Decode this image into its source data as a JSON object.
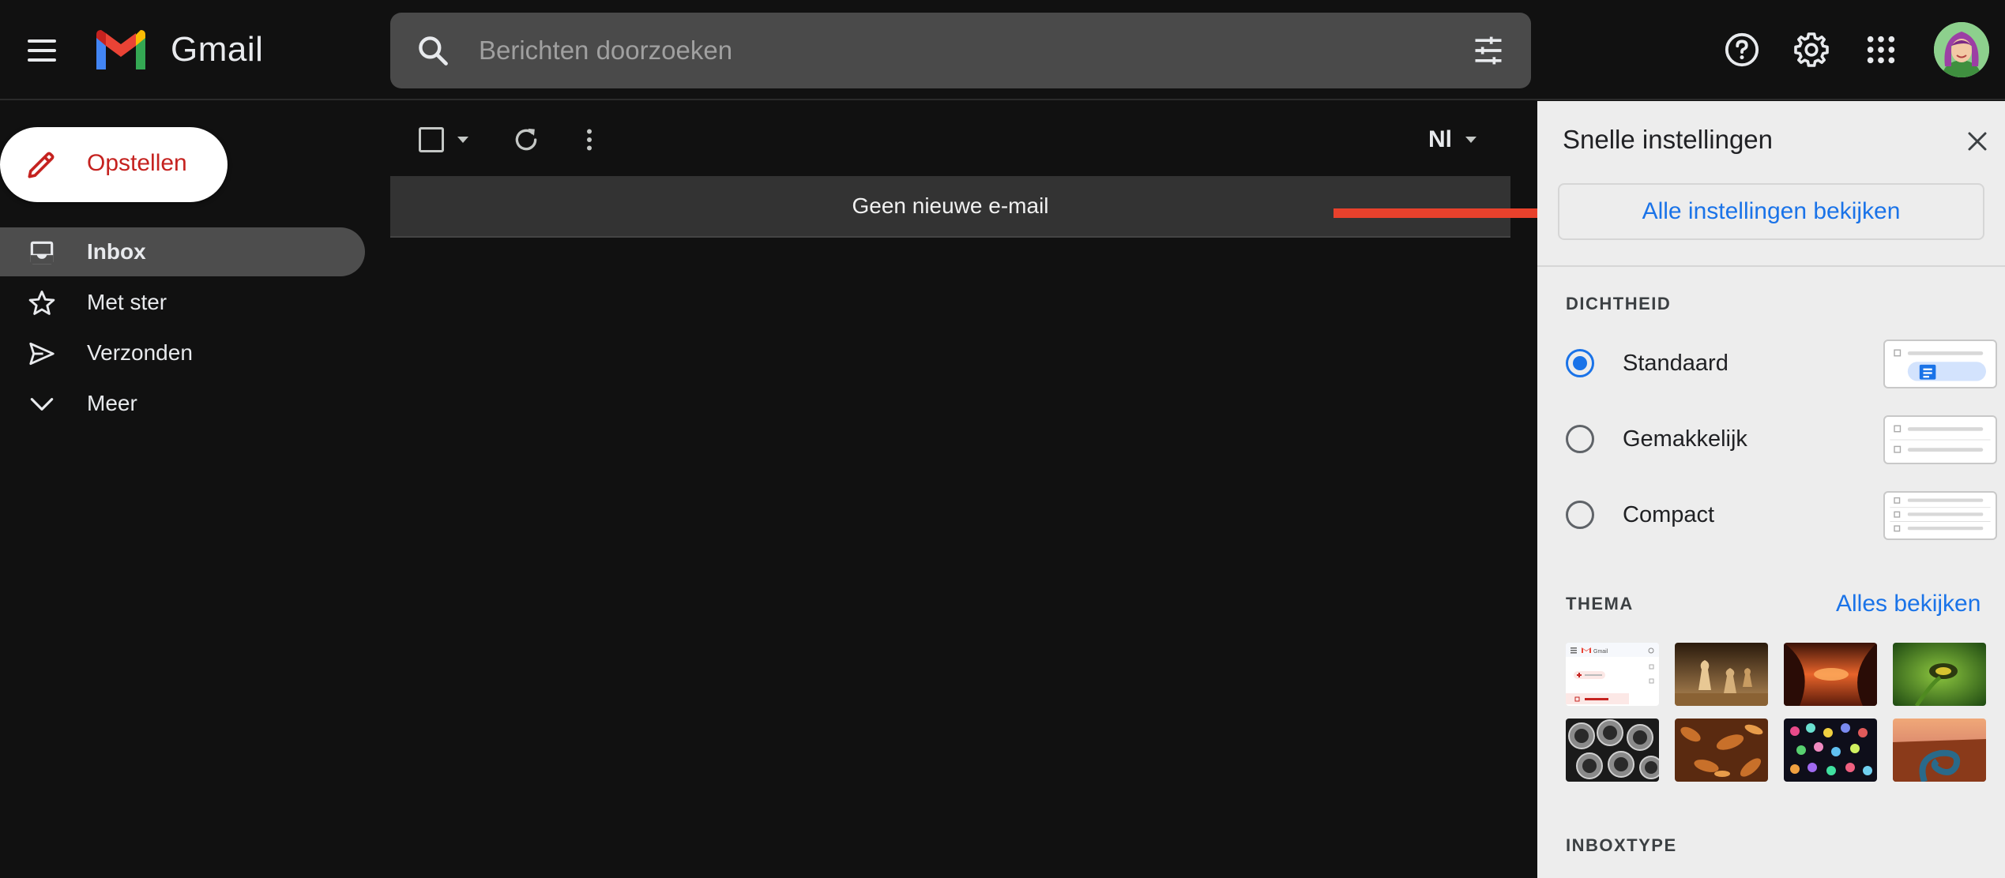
{
  "app": {
    "name": "Gmail"
  },
  "search": {
    "placeholder": "Berichten doorzoeken"
  },
  "compose": {
    "label": "Opstellen"
  },
  "sidebar": {
    "items": [
      {
        "label": "Inbox",
        "icon": "inbox-icon",
        "active": true
      },
      {
        "label": "Met ster",
        "icon": "star-icon",
        "active": false
      },
      {
        "label": "Verzonden",
        "icon": "send-icon",
        "active": false
      },
      {
        "label": "Meer",
        "icon": "chevron-down-icon",
        "active": false
      }
    ]
  },
  "toolbar": {
    "language": "Nl"
  },
  "mail": {
    "empty_message": "Geen nieuwe e-mail"
  },
  "quick_settings": {
    "title": "Snelle instellingen",
    "all_settings": "Alle instellingen bekijken",
    "density_label": "DICHTHEID",
    "density_options": [
      {
        "label": "Standaard",
        "selected": true
      },
      {
        "label": "Gemakkelijk",
        "selected": false
      },
      {
        "label": "Compact",
        "selected": false
      }
    ],
    "theme_label": "THEMA",
    "theme_see_all": "Alles bekijken",
    "inbox_type_label": "INBOXTYPE"
  },
  "colors": {
    "accent": "#1a73e8",
    "compose_text": "#c5221f",
    "arrow": "#e8412c",
    "background": "#111111",
    "panel": "#ededed"
  }
}
